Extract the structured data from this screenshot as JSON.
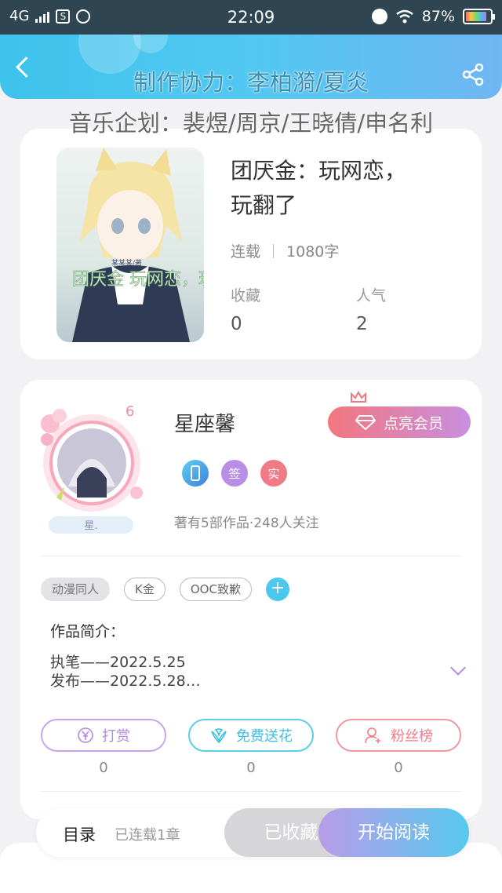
{
  "status_bar": {
    "network": "4G",
    "sim_icon_label": "S",
    "time": "22:09",
    "battery": "87%",
    "battery_level": 0.87
  },
  "header": {
    "credit_production": "制作协力：李柏漪/夏炎",
    "credit_music": "音乐企划：裴煜/周京/王晓倩/申名利"
  },
  "book": {
    "title_line1": "团厌金：玩网恋，",
    "title_line2": "玩翻了",
    "status": "连载",
    "word_count": "1080字",
    "favorites_label": "收藏",
    "favorites_value": "0",
    "popularity_label": "人气",
    "popularity_value": "2",
    "cover_text_small": "某某某/著",
    "cover_text_big": "团厌金 玩网恋，玩翻了"
  },
  "author": {
    "name": "星座馨",
    "level": "6",
    "nameplate": "星.",
    "vip_label": "点亮会员",
    "badges": [
      "签",
      "实"
    ],
    "stats": "著有5部作品·248人关注"
  },
  "tags": {
    "items": [
      "动漫同人",
      "K金",
      "OOC致歉"
    ],
    "add_label": "+"
  },
  "intro": {
    "heading": "作品简介：",
    "line1": "执笔——2022.5.25",
    "line2": "发布——2022.5.28…"
  },
  "actions": {
    "reward_label": "打赏",
    "reward_count": "0",
    "flower_label": "免费送花",
    "flower_count": "0",
    "fans_label": "粉丝榜",
    "fans_count": "0"
  },
  "bottom": {
    "toc_label": "目录",
    "toc_count": "已连载1章",
    "collected_label": "已收藏",
    "read_label": "开始阅读"
  },
  "colors": {
    "accent_blue": "#4cc7ee",
    "accent_purple": "#b08be0",
    "accent_pink": "#f3767e"
  }
}
